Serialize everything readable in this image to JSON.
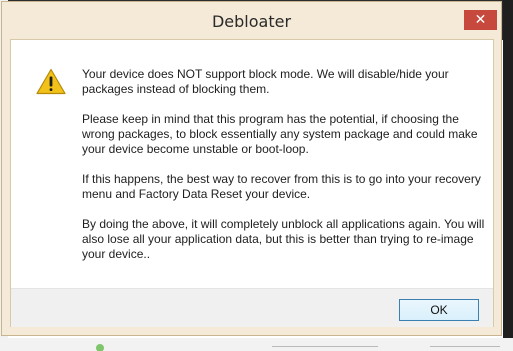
{
  "window": {
    "title": "Debloater",
    "close_glyph": "✕"
  },
  "icon": {
    "name": "warning-icon",
    "color": "#f2c21b"
  },
  "message": {
    "paragraphs": [
      "Your device does NOT support block mode.  We will disable/hide your packages instead of blocking them.",
      "Please keep in mind that this program has the potential, if choosing the wrong packages, to block essentially any system package and could make your device become unstable or boot-loop.",
      "If this happens, the best way to recover from this is to go into your recovery menu and Factory Data Reset your device.",
      "By doing the above, it will completely unblock all applications again. You will also lose all your application data, but this is better than trying to re-image your device.."
    ]
  },
  "footer": {
    "ok_label": "OK"
  },
  "colors": {
    "frame": "#f4ead7",
    "close_button": "#c7483d",
    "ok_border": "#3c7fb1"
  }
}
